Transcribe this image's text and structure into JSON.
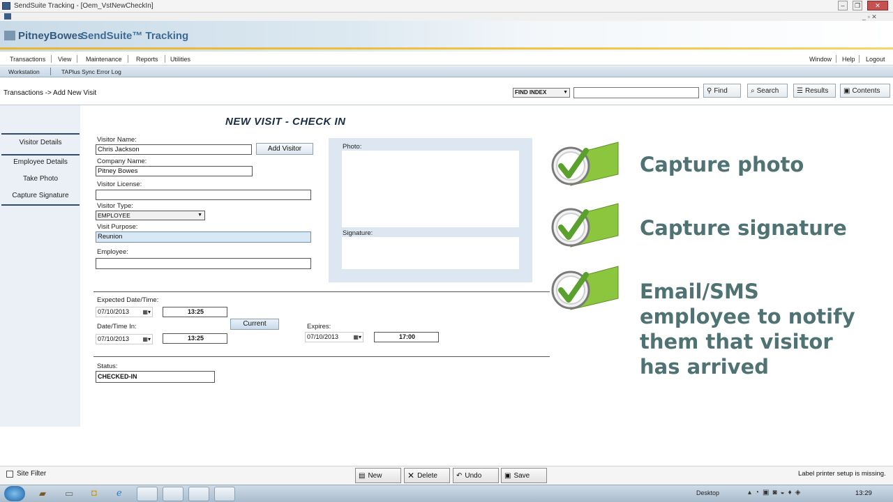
{
  "window": {
    "title": "SendSuite Tracking - [Oem_VstNewCheckIn]"
  },
  "banner": {
    "brand": "PitneyBowes",
    "product": "SendSuite™ Tracking"
  },
  "menu": {
    "left": [
      "Transactions",
      "View",
      "Maintenance",
      "Reports",
      "Utilities"
    ],
    "right": [
      "Window",
      "Help",
      "Logout"
    ]
  },
  "submenu": [
    "Workstation",
    "TAPlus Sync Error Log"
  ],
  "breadcrumb": "Transactions -> Add New Visit",
  "toolbar": {
    "index_select": "FIND INDEX",
    "find_value": "",
    "find": "Find",
    "search": "Search",
    "results": "Results",
    "contents": "Contents"
  },
  "nav": [
    "Visitor Details",
    "Employee Details",
    "Take Photo",
    "Capture Signature"
  ],
  "form": {
    "title": "NEW VISIT - CHECK IN",
    "visitor_name_label": "Visitor Name:",
    "visitor_name": "Chris Jackson",
    "add_visitor": "Add Visitor",
    "company_label": "Company Name:",
    "company": "Pitney Bowes",
    "license_label": "Visitor License:",
    "license": "",
    "type_label": "Visitor Type:",
    "type": "EMPLOYEE",
    "purpose_label": "Visit Purpose:",
    "purpose": "Reunion",
    "employee_label": "Employee:",
    "employee": "",
    "photo_label": "Photo:",
    "signature_label": "Signature:",
    "expected_label": "Expected Date/Time:",
    "expected_date": "07/10/2013",
    "expected_time": "13:25",
    "current": "Current",
    "in_label": "Date/Time In:",
    "in_date": "07/10/2013",
    "in_time": "13:25",
    "expires_label": "Expires:",
    "expires_date": "07/10/2013",
    "expires_time": "17:00",
    "status_label": "Status:",
    "status": "CHECKED-IN"
  },
  "callouts": [
    "Capture photo",
    "Capture signature",
    "Email/SMS employee to notify them that visitor has arrived"
  ],
  "bottom": {
    "site_filter": "Site Filter",
    "new": "New",
    "delete": "Delete",
    "undo": "Undo",
    "save": "Save",
    "status_message": "Label printer setup is missing."
  },
  "taskbar": {
    "desktop": "Desktop",
    "clock": "13:29"
  },
  "colors": {
    "accent_gold": "#e9b52c",
    "callout_text": "#4f7272",
    "check_green": "#8cc63f"
  }
}
